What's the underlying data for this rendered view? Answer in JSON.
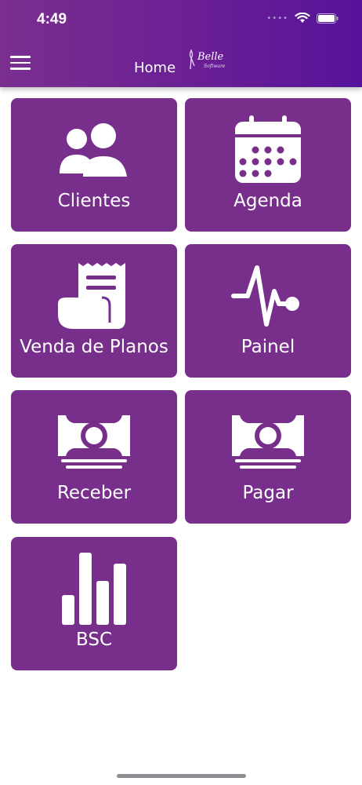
{
  "status_bar": {
    "time": "4:49"
  },
  "header": {
    "title": "Home",
    "logo_text": "Belle",
    "logo_subtext": "Software",
    "menu_icon": "hamburger-menu-icon"
  },
  "tiles": [
    {
      "label": "Clientes",
      "icon": "users-icon"
    },
    {
      "label": "Agenda",
      "icon": "calendar-icon"
    },
    {
      "label": "Venda de Planos",
      "icon": "receipt-icon"
    },
    {
      "label": "Painel",
      "icon": "pulse-icon"
    },
    {
      "label": "Receber",
      "icon": "money-icon"
    },
    {
      "label": "Pagar",
      "icon": "money-icon"
    },
    {
      "label": "BSC",
      "icon": "bar-chart-icon"
    }
  ],
  "colors": {
    "header_start": "#7a2f8f",
    "header_end": "#56139a",
    "tile": "#772f8b",
    "text": "#ffffff"
  }
}
